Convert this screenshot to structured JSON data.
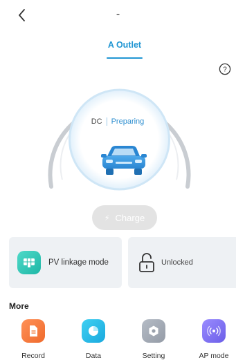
{
  "header": {
    "title": "-",
    "back_icon": "chevron-left-icon"
  },
  "tabs": [
    {
      "label": "A Outlet",
      "active": true
    }
  ],
  "help_icon": "question-circle-icon",
  "gauge": {
    "connector_type": "DC",
    "status": "Preparing",
    "car_icon": "car-icon",
    "arc_color": "#c9cdd2",
    "ring_color": "#cfe6f6",
    "accent_color": "#2e8fd0"
  },
  "charge_button": {
    "label": "Charge",
    "icon": "lightning-icon",
    "enabled": false
  },
  "cards": {
    "pv": {
      "label": "PV linkage mode",
      "icon": "solar-panel-icon",
      "color": "#2cc4b3"
    },
    "lock": {
      "label": "Unlocked",
      "icon": "unlock-icon"
    }
  },
  "more": {
    "title": "More",
    "items": [
      {
        "label": "Record",
        "icon": "document-icon",
        "color": "#f37a3b"
      },
      {
        "label": "Data",
        "icon": "pie-chart-icon",
        "color": "#27bfe8"
      },
      {
        "label": "Setting",
        "icon": "gear-icon",
        "color": "#a3aab5"
      },
      {
        "label": "AP mode",
        "icon": "wifi-signal-icon",
        "color": "#7b6ff0"
      }
    ]
  }
}
